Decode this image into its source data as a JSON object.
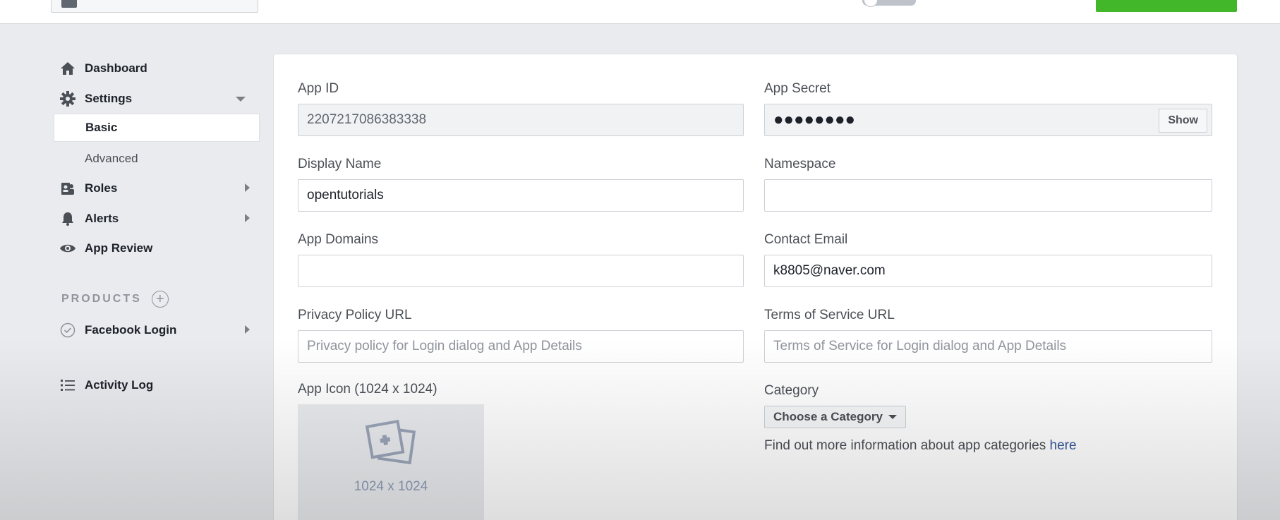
{
  "sidebar": {
    "dashboard_label": "Dashboard",
    "settings_label": "Settings",
    "settings_sub": [
      "Basic",
      "Advanced"
    ],
    "roles_label": "Roles",
    "alerts_label": "Alerts",
    "app_review_label": "App Review",
    "products_heading": "PRODUCTS",
    "facebook_login_label": "Facebook Login",
    "activity_log_label": "Activity Log"
  },
  "form": {
    "app_id": {
      "label": "App ID",
      "value": "2207217086383338"
    },
    "app_secret": {
      "label": "App Secret",
      "value": "●●●●●●●●",
      "show_label": "Show"
    },
    "display_name": {
      "label": "Display Name",
      "value": "opentutorials"
    },
    "namespace": {
      "label": "Namespace",
      "value": ""
    },
    "app_domains": {
      "label": "App Domains",
      "value": ""
    },
    "contact_email": {
      "label": "Contact Email",
      "value": "k8805@naver.com"
    },
    "privacy_policy_url": {
      "label": "Privacy Policy URL",
      "placeholder": "Privacy policy for Login dialog and App Details"
    },
    "terms_of_service_url": {
      "label": "Terms of Service URL",
      "placeholder": "Terms of Service for Login dialog and App Details"
    },
    "app_icon": {
      "label": "App Icon (1024 x 1024)",
      "size_text": "1024 x 1024"
    },
    "category": {
      "label": "Category",
      "button_label": "Choose a Category",
      "help_text": "Find out more information about app categories ",
      "help_link": "here"
    }
  },
  "colors": {
    "page_bg": "#e9ebee",
    "accent_green": "#42b72a",
    "link_blue": "#365899"
  }
}
